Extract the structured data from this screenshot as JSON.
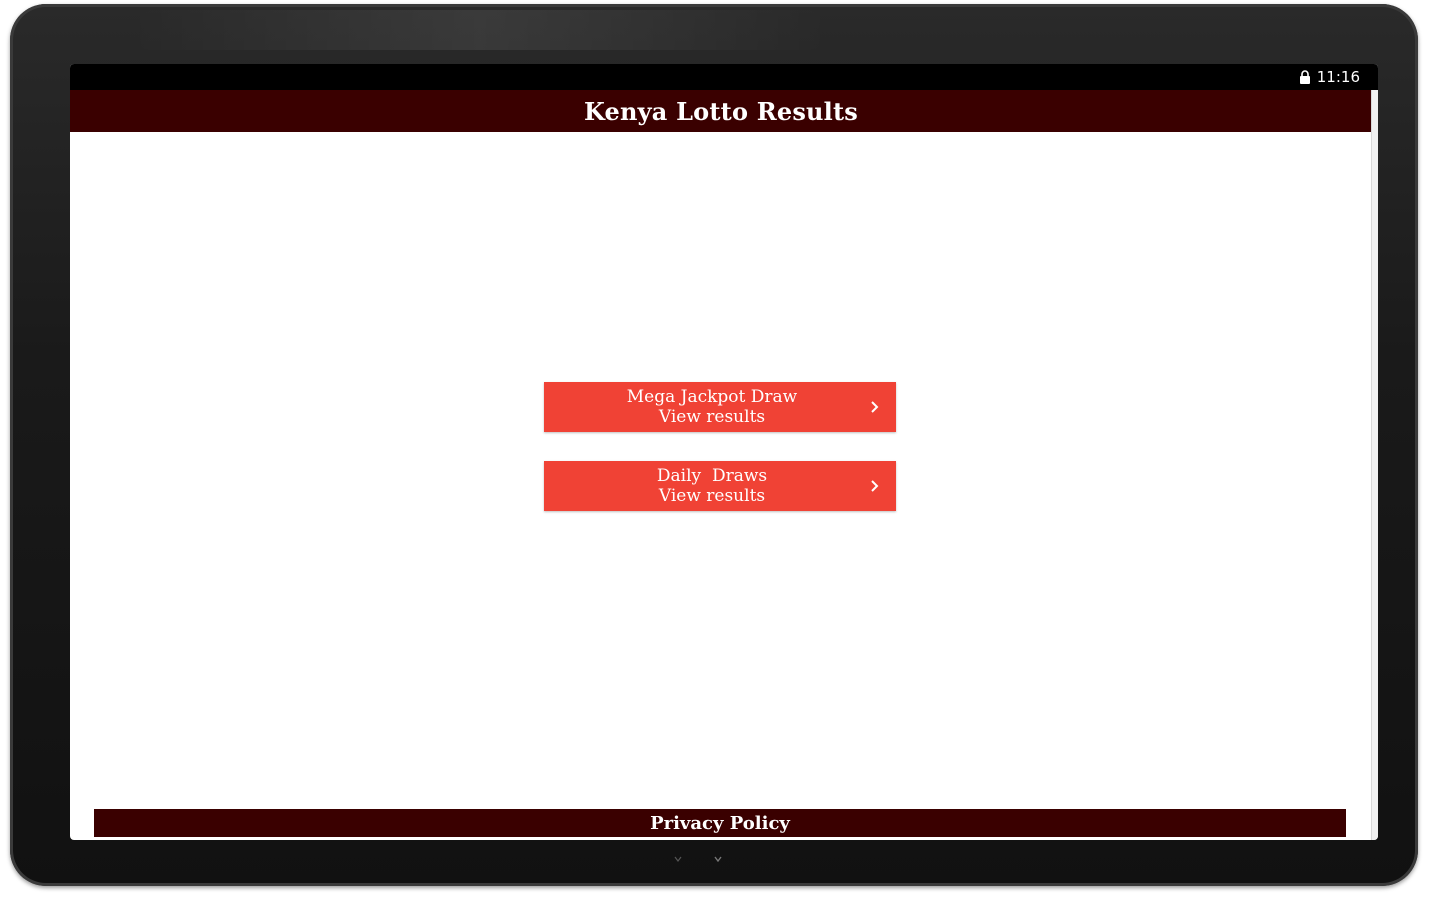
{
  "status_bar": {
    "time": "11:16",
    "icons": [
      "lock-icon"
    ]
  },
  "app": {
    "title": "Kenya Lotto Results"
  },
  "menu": {
    "items": [
      {
        "line1": "Mega Jackpot Draw",
        "line2": "View results",
        "icon": "chevron-right-icon"
      },
      {
        "line1": "Daily  Draws",
        "line2": "View results",
        "icon": "chevron-right-icon"
      }
    ]
  },
  "footer": {
    "link_label": "Privacy Policy"
  },
  "colors": {
    "header": "#3a0000",
    "button": "#f04235",
    "status_bar": "#000000"
  }
}
